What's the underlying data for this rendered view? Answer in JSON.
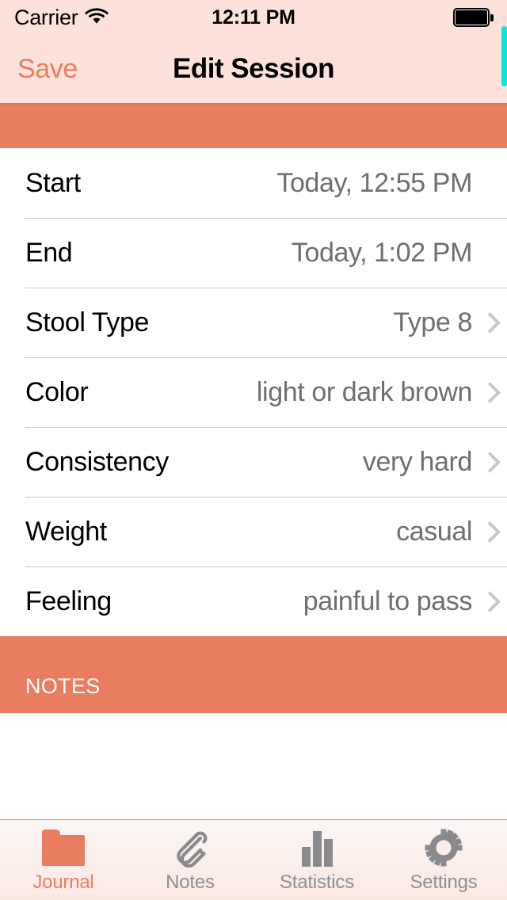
{
  "status_bar": {
    "carrier": "Carrier",
    "wifi_icon": "wifi-icon",
    "time": "12:11 PM",
    "battery_icon": "battery-full-icon"
  },
  "nav_bar": {
    "save_label": "Save",
    "title": "Edit Session"
  },
  "scroll_indicator": {
    "name": "vertical-scroll-indicator",
    "color": "#10E2E2"
  },
  "theme": {
    "accent": "#E87E5F",
    "nav_background": "#FCE2DB",
    "band": "#E87E5F",
    "separator": "#C8C7CC",
    "value_text": "#6E6E73",
    "chevron": "#C7C7CC",
    "inactive_tab": "#8E8E93"
  },
  "form": {
    "rows": [
      {
        "label": "Start",
        "value": "Today, 12:55 PM",
        "has_chevron": false
      },
      {
        "label": "End",
        "value": "Today, 1:02 PM",
        "has_chevron": false
      },
      {
        "label": "Stool Type",
        "value": "Type 8",
        "has_chevron": true
      },
      {
        "label": "Color",
        "value": "light or dark brown",
        "has_chevron": true
      },
      {
        "label": "Consistency",
        "value": "very hard",
        "has_chevron": true
      },
      {
        "label": "Weight",
        "value": "casual",
        "has_chevron": true
      },
      {
        "label": "Feeling",
        "value": "painful to pass",
        "has_chevron": true
      }
    ]
  },
  "notes_section": {
    "header": "NOTES",
    "text": ""
  },
  "tab_bar": {
    "tabs": [
      {
        "label": "Journal",
        "icon": "folder-icon",
        "active": true
      },
      {
        "label": "Notes",
        "icon": "paperclip-icon",
        "active": false
      },
      {
        "label": "Statistics",
        "icon": "bar-chart-icon",
        "active": false
      },
      {
        "label": "Settings",
        "icon": "gear-icon",
        "active": false
      }
    ]
  }
}
